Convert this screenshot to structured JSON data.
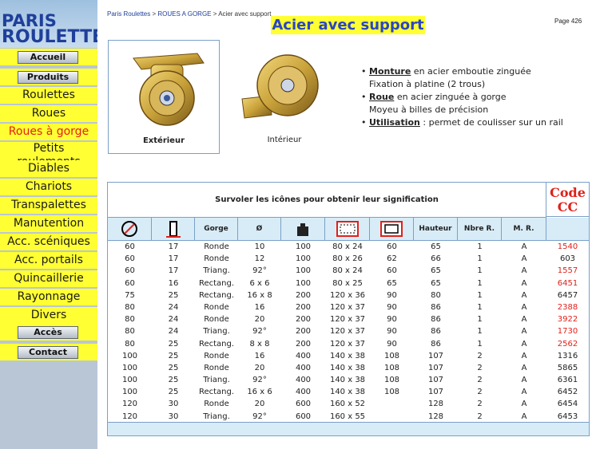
{
  "logo": {
    "line1": "PARIS",
    "line2": "ROULETTES"
  },
  "nav": [
    {
      "label": "Accueil",
      "kind": "button"
    },
    {
      "label": "Produits",
      "kind": "button"
    },
    {
      "label": "Roulettes",
      "kind": "text"
    },
    {
      "label": "Roues",
      "kind": "text"
    },
    {
      "label": "Roues à gorge",
      "kind": "text",
      "selected": true
    },
    {
      "label": "Petits roulements",
      "kind": "text2"
    },
    {
      "label": "Diables",
      "kind": "text"
    },
    {
      "label": "Chariots",
      "kind": "text"
    },
    {
      "label": "Transpalettes",
      "kind": "text"
    },
    {
      "label": "Manutention",
      "kind": "text"
    },
    {
      "label": "Acc. scéniques",
      "kind": "text"
    },
    {
      "label": "Acc. portails",
      "kind": "text"
    },
    {
      "label": "Quincaillerie",
      "kind": "text"
    },
    {
      "label": "Rayonnage",
      "kind": "text"
    },
    {
      "label": "Divers",
      "kind": "text"
    },
    {
      "label": "Accès",
      "kind": "button"
    },
    {
      "label": "Contact",
      "kind": "button"
    }
  ],
  "breadcrumb": {
    "home": "Paris Roulettes",
    "sep": ">",
    "section": "ROUES A GORGE",
    "current": "Acier avec support"
  },
  "page_title": "Acier avec support",
  "page_number": "Page 426",
  "photos": {
    "exterior_caption": "Extérieur",
    "interior_caption": "Intérieur"
  },
  "features": [
    {
      "bullet": "•",
      "term": "Monture",
      "text": " en acier emboutie zinguée",
      "sub": "Fixation à platine (2 trous)"
    },
    {
      "bullet": "•",
      "term": "Roue",
      "text": " en acier zinguée à gorge",
      "sub": "Moyeu à billes de précision"
    },
    {
      "bullet": "•",
      "term": "Utilisation",
      "text": " : permet de coulisser sur un rail",
      "sub": ""
    }
  ],
  "table": {
    "hint": "Survoler les icônes pour obtenir leur signification",
    "code_header": "Code CC",
    "columns": [
      "",
      "",
      "Gorge",
      "Ø",
      "",
      "",
      "",
      "Hauteur",
      "Nbre R.",
      "M. R."
    ],
    "rows": [
      [
        "60",
        "17",
        "Ronde",
        "10",
        "100",
        "80 x 24",
        "60",
        "65",
        "1",
        "A",
        "1540",
        "red"
      ],
      [
        "60",
        "17",
        "Ronde",
        "12",
        "100",
        "80 x 26",
        "62",
        "66",
        "1",
        "A",
        "603",
        ""
      ],
      [
        "60",
        "17",
        "Triang.",
        "92°",
        "100",
        "80 x 24",
        "60",
        "65",
        "1",
        "A",
        "1557",
        "red"
      ],
      [
        "60",
        "16",
        "Rectang.",
        "6 x 6",
        "100",
        "80 x 25",
        "65",
        "65",
        "1",
        "A",
        "6451",
        "red"
      ],
      [
        "75",
        "25",
        "Rectang.",
        "16 x 8",
        "200",
        "120 x 36",
        "90",
        "80",
        "1",
        "A",
        "6457",
        ""
      ],
      [
        "80",
        "24",
        "Ronde",
        "16",
        "200",
        "120 x 37",
        "90",
        "86",
        "1",
        "A",
        "2388",
        "red"
      ],
      [
        "80",
        "24",
        "Ronde",
        "20",
        "200",
        "120 x 37",
        "90",
        "86",
        "1",
        "A",
        "3922",
        "red"
      ],
      [
        "80",
        "24",
        "Triang.",
        "92°",
        "200",
        "120 x 37",
        "90",
        "86",
        "1",
        "A",
        "1730",
        "red"
      ],
      [
        "80",
        "25",
        "Rectang.",
        "8 x 8",
        "200",
        "120 x 37",
        "90",
        "86",
        "1",
        "A",
        "2562",
        "red"
      ],
      [
        "100",
        "25",
        "Ronde",
        "16",
        "400",
        "140 x 38",
        "108",
        "107",
        "2",
        "A",
        "1316",
        ""
      ],
      [
        "100",
        "25",
        "Ronde",
        "20",
        "400",
        "140 x 38",
        "108",
        "107",
        "2",
        "A",
        "5865",
        ""
      ],
      [
        "100",
        "25",
        "Triang.",
        "92°",
        "400",
        "140 x 38",
        "108",
        "107",
        "2",
        "A",
        "6361",
        ""
      ],
      [
        "100",
        "25",
        "Rectang.",
        "16 x 6",
        "400",
        "140 x 38",
        "108",
        "107",
        "2",
        "A",
        "6452",
        ""
      ],
      [
        "120",
        "30",
        "Ronde",
        "20",
        "600",
        "160 x 52",
        "",
        "128",
        "2",
        "A",
        "6454",
        ""
      ],
      [
        "120",
        "30",
        "Triang.",
        "92°",
        "600",
        "160 x 55",
        "",
        "128",
        "2",
        "A",
        "6453",
        ""
      ]
    ]
  },
  "colors": {
    "nav_bg": "#ffff33",
    "selected": "#e0211a",
    "title": "#2a46c2",
    "accent_border": "#7aa0c8",
    "header_bg": "#d8ecf7"
  },
  "icons": [
    "wheel-diameter-icon",
    "wheel-width-icon",
    "load-weight-icon",
    "plate-size-icon",
    "hole-spacing-icon"
  ]
}
